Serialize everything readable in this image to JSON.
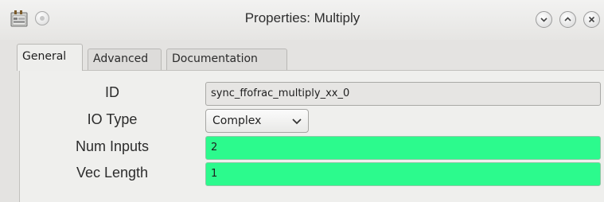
{
  "window": {
    "title": "Properties: Multiply"
  },
  "icons": {
    "app": "app-window-icon",
    "system_menu": "system-menu-icon",
    "minimize": "chevron-down-icon",
    "maximize": "chevron-up-icon",
    "close": "close-icon"
  },
  "tabs": [
    {
      "label": "General",
      "active": true
    },
    {
      "label": "Advanced",
      "active": false
    },
    {
      "label": "Documentation",
      "active": false
    }
  ],
  "fields": {
    "id": {
      "label": "ID",
      "value": "sync_ffofrac_multiply_xx_0"
    },
    "io_type": {
      "label": "IO Type",
      "value": "Complex"
    },
    "num_inputs": {
      "label": "Num Inputs",
      "value": "2"
    },
    "vec_length": {
      "label": "Vec Length",
      "value": "1"
    }
  },
  "colors": {
    "valid_field": "#2cfa8d",
    "readonly_field": "#e6e5e3"
  }
}
